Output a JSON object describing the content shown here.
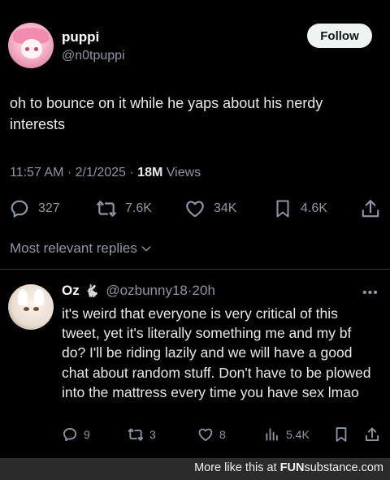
{
  "post": {
    "display_name": "puppi",
    "handle": "@n0tpuppi",
    "follow_label": "Follow",
    "text": "oh to bounce on it while he yaps about his nerdy interests",
    "time": "11:57 AM",
    "date": "2/1/2025",
    "views_count": "18M",
    "views_label": "Views",
    "stats": {
      "replies": "327",
      "reposts": "7.6K",
      "likes": "34K",
      "bookmarks": "4.6K"
    }
  },
  "replies_sort_label": "Most relevant replies",
  "reply": {
    "display_name": "Oz",
    "emoji": "🐇",
    "handle": "@ozbunny18",
    "age": "20h",
    "more": "•••",
    "text": "it's weird that everyone is very critical of this tweet, yet it's literally something me and my bf do? I'll be riding lazily and we will have a good chat about random stuff. Don't have to be plowed into the mattress every time you have sex lmao",
    "stats": {
      "replies": "9",
      "reposts": "3",
      "likes": "8",
      "views": "5.4K"
    }
  },
  "footer": {
    "prefix": "More like this at ",
    "brand_fun": "FUN",
    "brand_rest": "substance.com"
  },
  "colors": {
    "background": "#000000",
    "text": "#e7e9ea",
    "muted": "#8b98a5",
    "follow_bg": "#eff3f4"
  },
  "icons": [
    "reply-icon",
    "repost-icon",
    "like-icon",
    "bookmark-icon",
    "share-icon",
    "views-icon",
    "chevron-down-icon",
    "more-icon"
  ]
}
